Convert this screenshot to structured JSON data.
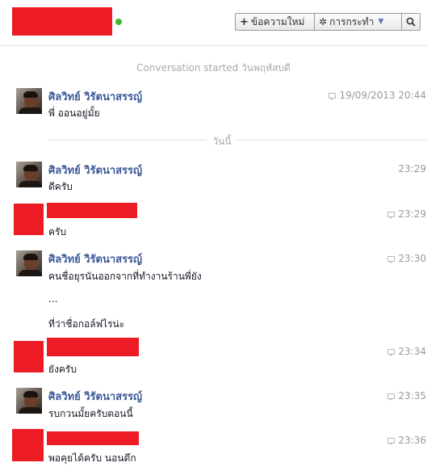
{
  "header": {
    "new_message_label": "ข้อความใหม่",
    "actions_label": "การกระทำ",
    "new_message_glyph": "+",
    "actions_glyph": "✲",
    "caret_glyph": "▼",
    "search_glyph": "🔍"
  },
  "conversation": {
    "started_text": "Conversation started วันพฤหัสบดี",
    "day_separator": "วันนี้"
  },
  "messages": [
    {
      "sender": "ศิลวิทย์ วิรัตนาสรรญ์",
      "lines": [
        "พี่ ออนอยู่มั้ย"
      ],
      "time": "19/09/2013 20:44",
      "show_bubble": true
    },
    {
      "sender": "ศิลวิทย์ วิรัตนาสรรญ์",
      "lines": [
        "ดีครับ"
      ],
      "time": "23:29",
      "show_bubble": false
    },
    {
      "sender": "",
      "lines": [
        "ครับ"
      ],
      "time": "23:29",
      "show_bubble": true
    },
    {
      "sender": "ศิลวิทย์ วิรัตนาสรรญ์",
      "lines": [
        "คนชื่อยุรนันออกจากที่ทำงานร้านพี่ยัง",
        "...",
        "ที่ว่าชื่อกอล์ฟไรน่ะ"
      ],
      "time": "23:30",
      "show_bubble": true
    },
    {
      "sender": "",
      "lines": [
        "ยังครับ"
      ],
      "time": "23:34",
      "show_bubble": true
    },
    {
      "sender": "ศิลวิทย์ วิรัตนาสรรญ์",
      "lines": [
        "รบกวนมั้ยครับตอนนี้"
      ],
      "time": "23:35",
      "show_bubble": true
    },
    {
      "sender": "",
      "lines": [
        "พอคุยได้ครับ  นอนดึก"
      ],
      "time": "23:36",
      "show_bubble": true
    }
  ],
  "colors": {
    "redaction": "#ed1c24",
    "sender_link": "#3b5998",
    "online": "#42b72a"
  }
}
